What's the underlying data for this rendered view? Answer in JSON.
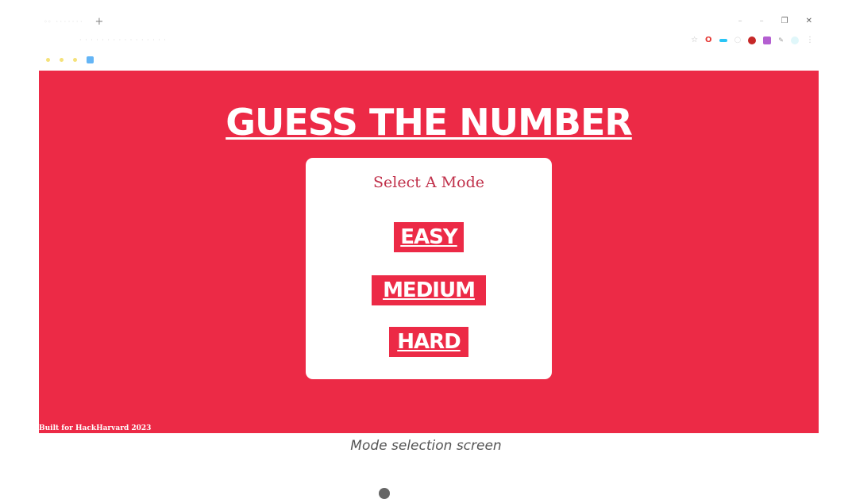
{
  "browser": {
    "new_tab_glyph": "+",
    "window_controls": [
      "–",
      "–",
      "❐",
      "✕"
    ],
    "bookmark_count": 4
  },
  "app": {
    "title": "GUESS THE NUMBER",
    "mode_heading": "Select A Mode",
    "modes": {
      "easy": "EASY",
      "medium": "MEDIUM",
      "hard": "HARD"
    },
    "footer": "Built for HackHarvard 2023",
    "colors": {
      "background": "#ec2a46",
      "card": "#ffffff",
      "heading_text": "#c0304a"
    }
  },
  "caption": "Mode selection screen"
}
